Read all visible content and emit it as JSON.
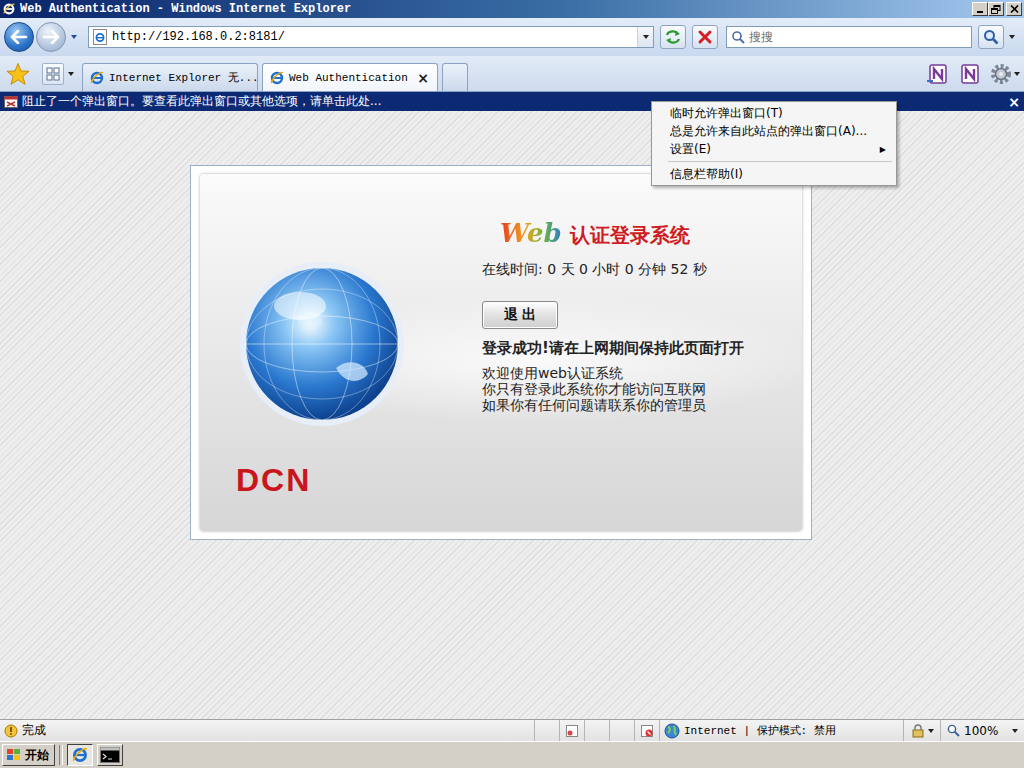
{
  "window": {
    "title": "Web Authentication - Windows Internet Explorer"
  },
  "address_bar": {
    "url": "http://192.168.0.2:8181/"
  },
  "search": {
    "placeholder": "搜搜"
  },
  "tab_bar": {
    "close_glyph": "×",
    "tabs": [
      {
        "label": "Internet Explorer 无...",
        "selected": false
      },
      {
        "label": "Web Authentication",
        "selected": true
      }
    ]
  },
  "info_bar": {
    "message": "阻止了一个弹出窗口。要查看此弹出窗口或其他选项，请单击此处...",
    "close_glyph": "×",
    "highlighted": true
  },
  "popup_menu": {
    "submenu_glyph": "▶",
    "items": [
      {
        "kind": "item",
        "label": "临时允许弹出窗口(T)",
        "submenu": false
      },
      {
        "kind": "item",
        "label": "总是允许来自此站点的弹出窗口(A)...",
        "submenu": false
      },
      {
        "kind": "item",
        "label": "设置(E)",
        "submenu": true
      },
      {
        "kind": "separator"
      },
      {
        "kind": "item",
        "label": "信息栏帮助(I)",
        "submenu": false
      }
    ]
  },
  "page": {
    "logo_word": "Web",
    "title": "认证登录系统",
    "online_time": "在线时间: 0 天 0 小时 0 分钟 52 秒",
    "logout_button": "退 出",
    "success": "登录成功!请在上网期间保持此页面打开",
    "lines": [
      "欢迎使用web认证系统",
      "你只有登录此系统你才能访问互联网",
      "如果你有任何问题请联系你的管理员"
    ],
    "brand": "DCN"
  },
  "status_bar": {
    "text": "完成",
    "zone": "Internet | 保护模式: 禁用",
    "zoom": "100%"
  },
  "taskbar": {
    "start": "开始"
  }
}
